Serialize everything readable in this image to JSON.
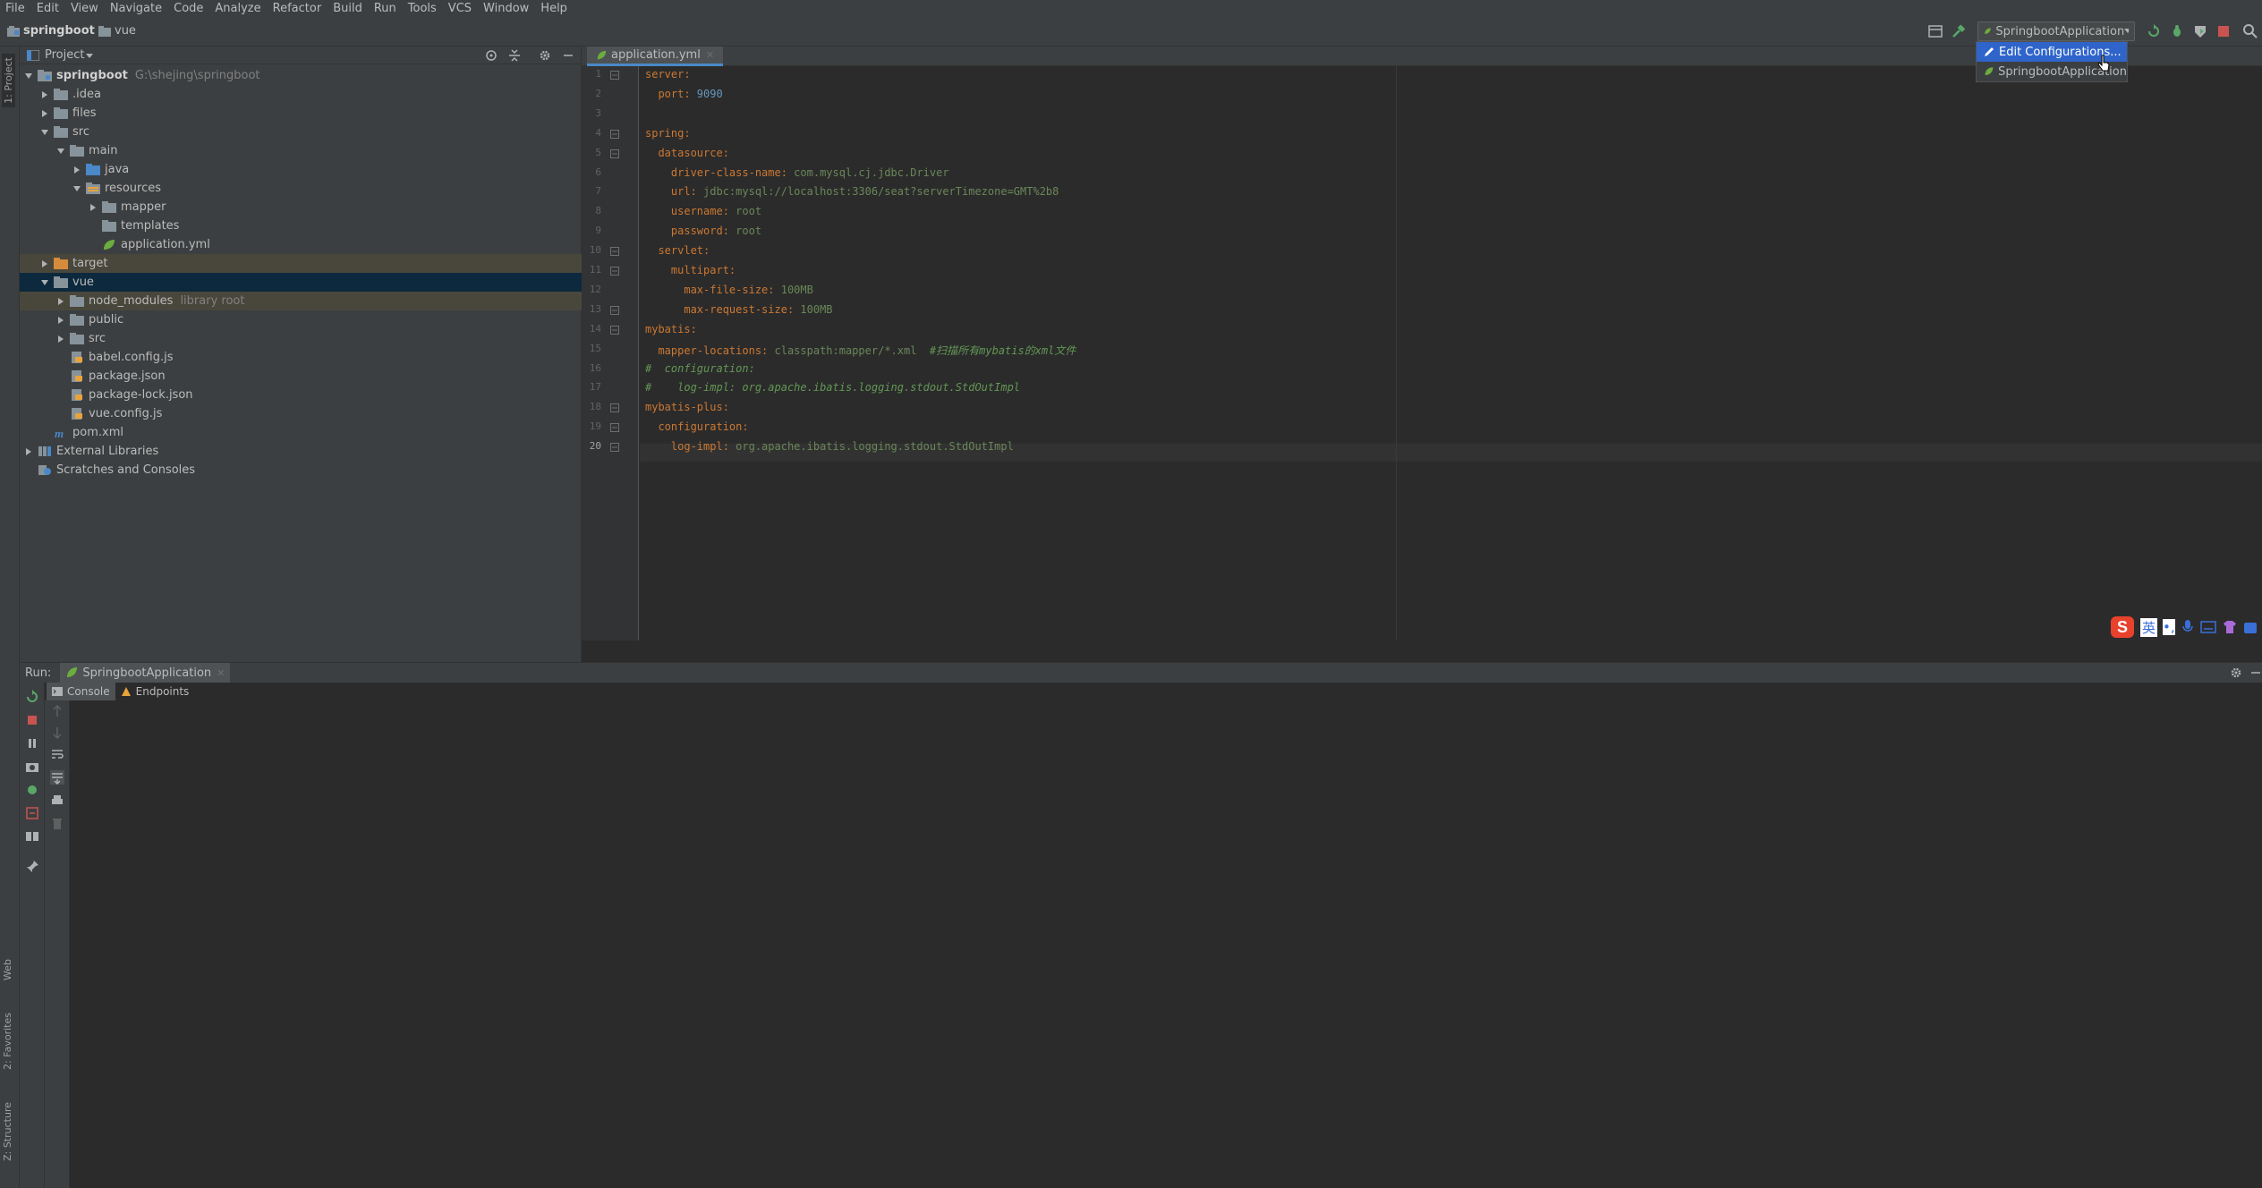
{
  "menu": [
    "File",
    "Edit",
    "View",
    "Navigate",
    "Code",
    "Analyze",
    "Refactor",
    "Build",
    "Run",
    "Tools",
    "VCS",
    "Window",
    "Help"
  ],
  "breadcrumb": {
    "project": "springboot",
    "folder": "vue"
  },
  "run_config": {
    "label": "SpringbootApplication"
  },
  "popup": {
    "items": [
      "Edit Configurations...",
      "SpringbootApplication"
    ]
  },
  "left_stripe": {
    "project": "1: Project",
    "web": "Web",
    "favorites": "2: Favorites",
    "structure": "Z: Structure"
  },
  "project_panel": {
    "title": "Project",
    "tree": [
      {
        "label": "springboot",
        "hint": "G:\\shejing\\springboot"
      },
      {
        "label": ".idea"
      },
      {
        "label": "files"
      },
      {
        "label": "src"
      },
      {
        "label": "main"
      },
      {
        "label": "java"
      },
      {
        "label": "resources"
      },
      {
        "label": "mapper"
      },
      {
        "label": "templates"
      },
      {
        "label": "application.yml"
      },
      {
        "label": "target"
      },
      {
        "label": "vue"
      },
      {
        "label": "node_modules",
        "hint": "library root"
      },
      {
        "label": "public"
      },
      {
        "label": "src"
      },
      {
        "label": "babel.config.js"
      },
      {
        "label": "package.json"
      },
      {
        "label": "package-lock.json"
      },
      {
        "label": "vue.config.js"
      },
      {
        "label": "pom.xml"
      },
      {
        "label": "External Libraries"
      },
      {
        "label": "Scratches and Consoles"
      }
    ]
  },
  "editor": {
    "tab": "application.yml",
    "lines": [
      {
        "num": "1",
        "key": "server:",
        "val": ""
      },
      {
        "num": "2",
        "key": "  port:",
        "val": " 9090"
      },
      {
        "num": "3",
        "key": "",
        "val": ""
      },
      {
        "num": "4",
        "key": "spring:",
        "val": ""
      },
      {
        "num": "5",
        "key": "  datasource:",
        "val": ""
      },
      {
        "num": "6",
        "key": "    driver-class-name:",
        "val": " com.mysql.cj.jdbc.Driver"
      },
      {
        "num": "7",
        "key": "    url:",
        "val": " jdbc:mysql://localhost:3306/seat?serverTimezone=GMT%2b8"
      },
      {
        "num": "8",
        "key": "    username:",
        "val": " root"
      },
      {
        "num": "9",
        "key": "    password:",
        "val": " root"
      },
      {
        "num": "10",
        "key": "  servlet:",
        "val": ""
      },
      {
        "num": "11",
        "key": "    multipart:",
        "val": ""
      },
      {
        "num": "12",
        "key": "      max-file-size:",
        "val": " 100MB"
      },
      {
        "num": "13",
        "key": "      max-request-size:",
        "val": " 100MB"
      },
      {
        "num": "14",
        "key": "mybatis:",
        "val": ""
      },
      {
        "num": "15",
        "key": "  mapper-locations:",
        "val": " classpath:mapper/*.xml  ",
        "comment": "#扫描所有mybatis的xml文件"
      },
      {
        "num": "16",
        "key": "",
        "val": "",
        "comment": "#  configuration:"
      },
      {
        "num": "17",
        "key": "",
        "val": "",
        "comment": "#    log-impl: org.apache.ibatis.logging.stdout.StdOutImpl"
      },
      {
        "num": "18",
        "key": "mybatis-plus:",
        "val": ""
      },
      {
        "num": "19",
        "key": "  configuration:",
        "val": ""
      },
      {
        "num": "20",
        "key": "    log-impl:",
        "val": " org.apache.ibatis.logging.stdout.StdOutImpl"
      }
    ]
  },
  "run_panel": {
    "label": "Run:",
    "tab": "SpringbootApplication",
    "subtabs": [
      "Console",
      "Endpoints"
    ]
  },
  "ime": {
    "mode": "英"
  }
}
